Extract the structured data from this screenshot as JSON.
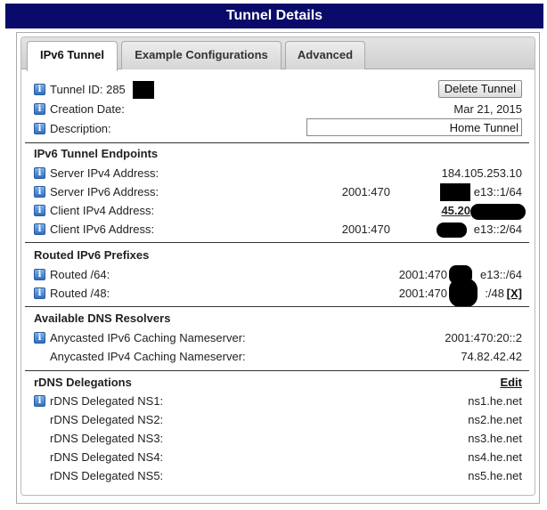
{
  "title": "Tunnel Details",
  "tabs": [
    "IPv6 Tunnel",
    "Example Configurations",
    "Advanced"
  ],
  "info": {
    "tunnel_id_label": "Tunnel ID: 285",
    "delete_button": "Delete Tunnel",
    "creation_label": "Creation Date:",
    "creation_value": "Mar 21, 2015",
    "description_label": "Description:",
    "description_value": "Home Tunnel"
  },
  "endpoints": {
    "title": "IPv6 Tunnel Endpoints",
    "server_ipv4_label": "Server IPv4 Address:",
    "server_ipv4_value": "184.105.253.10",
    "server_ipv6_label": "Server IPv6 Address:",
    "server_ipv6_a": "2001:470",
    "server_ipv6_b": "e13::1/64",
    "client_ipv4_label": "Client IPv4 Address:",
    "client_ipv4_value": "45.20",
    "client_ipv6_label": "Client IPv6 Address:",
    "client_ipv6_a": "2001:470",
    "client_ipv6_b": "e13::2/64"
  },
  "prefixes": {
    "title": "Routed IPv6 Prefixes",
    "r64_label": "Routed /64:",
    "r64_a": "2001:470",
    "r64_b": "e13::/64",
    "r48_label": "Routed /48:",
    "r48_a": "2001:470",
    "r48_b": ":/48",
    "r48_link": "[X]"
  },
  "dns": {
    "title": "Available DNS Resolvers",
    "v6_label": "Anycasted IPv6 Caching Nameserver:",
    "v6_value": "2001:470:20::2",
    "v4_label": "Anycasted IPv4 Caching Nameserver:",
    "v4_value": "74.82.42.42"
  },
  "rdns": {
    "title": "rDNS Delegations",
    "edit": "Edit",
    "items": [
      {
        "label": "rDNS Delegated NS1:",
        "value": "ns1.he.net"
      },
      {
        "label": "rDNS Delegated NS2:",
        "value": "ns2.he.net"
      },
      {
        "label": "rDNS Delegated NS3:",
        "value": "ns3.he.net"
      },
      {
        "label": "rDNS Delegated NS4:",
        "value": "ns4.he.net"
      },
      {
        "label": "rDNS Delegated NS5:",
        "value": "ns5.he.net"
      }
    ]
  }
}
